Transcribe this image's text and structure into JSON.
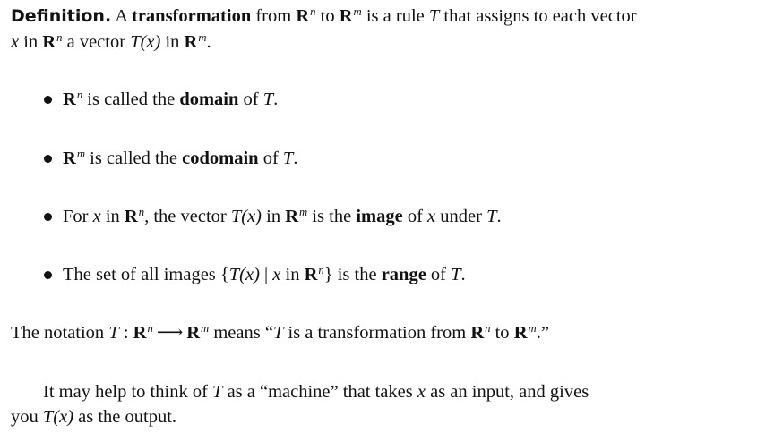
{
  "definition": {
    "label": "Definition.",
    "t1": "A",
    "term": "transformation",
    "t2": "from",
    "R": "R",
    "n": "n",
    "m": "m",
    "t3": "to",
    "t4": "is a rule",
    "T": "T",
    "t5": "that assigns to each vector",
    "x": "x",
    "t6": "in",
    "t7": "a vector",
    "Tx": "T(x)",
    "t8": "in",
    "period": "."
  },
  "bullets": [
    {
      "pre": "",
      "mid": " is called the ",
      "term": "domain",
      "post": " of ",
      "T": "T",
      "end": "."
    },
    {
      "pre": "",
      "mid": " is called the ",
      "term": "codomain",
      "post": " of ",
      "T": "T",
      "end": "."
    },
    {
      "a": "For",
      "x": "x",
      "b": "in",
      "c": ", the vector",
      "Tx": "T(x)",
      "d": "in",
      "e": "is the",
      "term": "image",
      "f": "of",
      "g": "under",
      "T": "T",
      "end": "."
    },
    {
      "a": "The set of all images {",
      "Tx": "T(x)",
      "bar": " | ",
      "x": "x",
      "b": " in ",
      "c": "} is the ",
      "term": "range",
      "d": " of ",
      "T": "T",
      "end": "."
    }
  ],
  "notation": {
    "a": "The notation",
    "T": "T",
    "colon": " : ",
    "arrow": "⟶",
    "b": "means “",
    "c": "is a transformation from",
    "d": "to",
    "end": ".”"
  },
  "machine": {
    "a": "It may help to think of",
    "T": "T",
    "b": "as a “machine” that takes",
    "x": "x",
    "c": "as an input, and gives",
    "d": "you",
    "Tx": "T(x)",
    "e": "as the output."
  }
}
